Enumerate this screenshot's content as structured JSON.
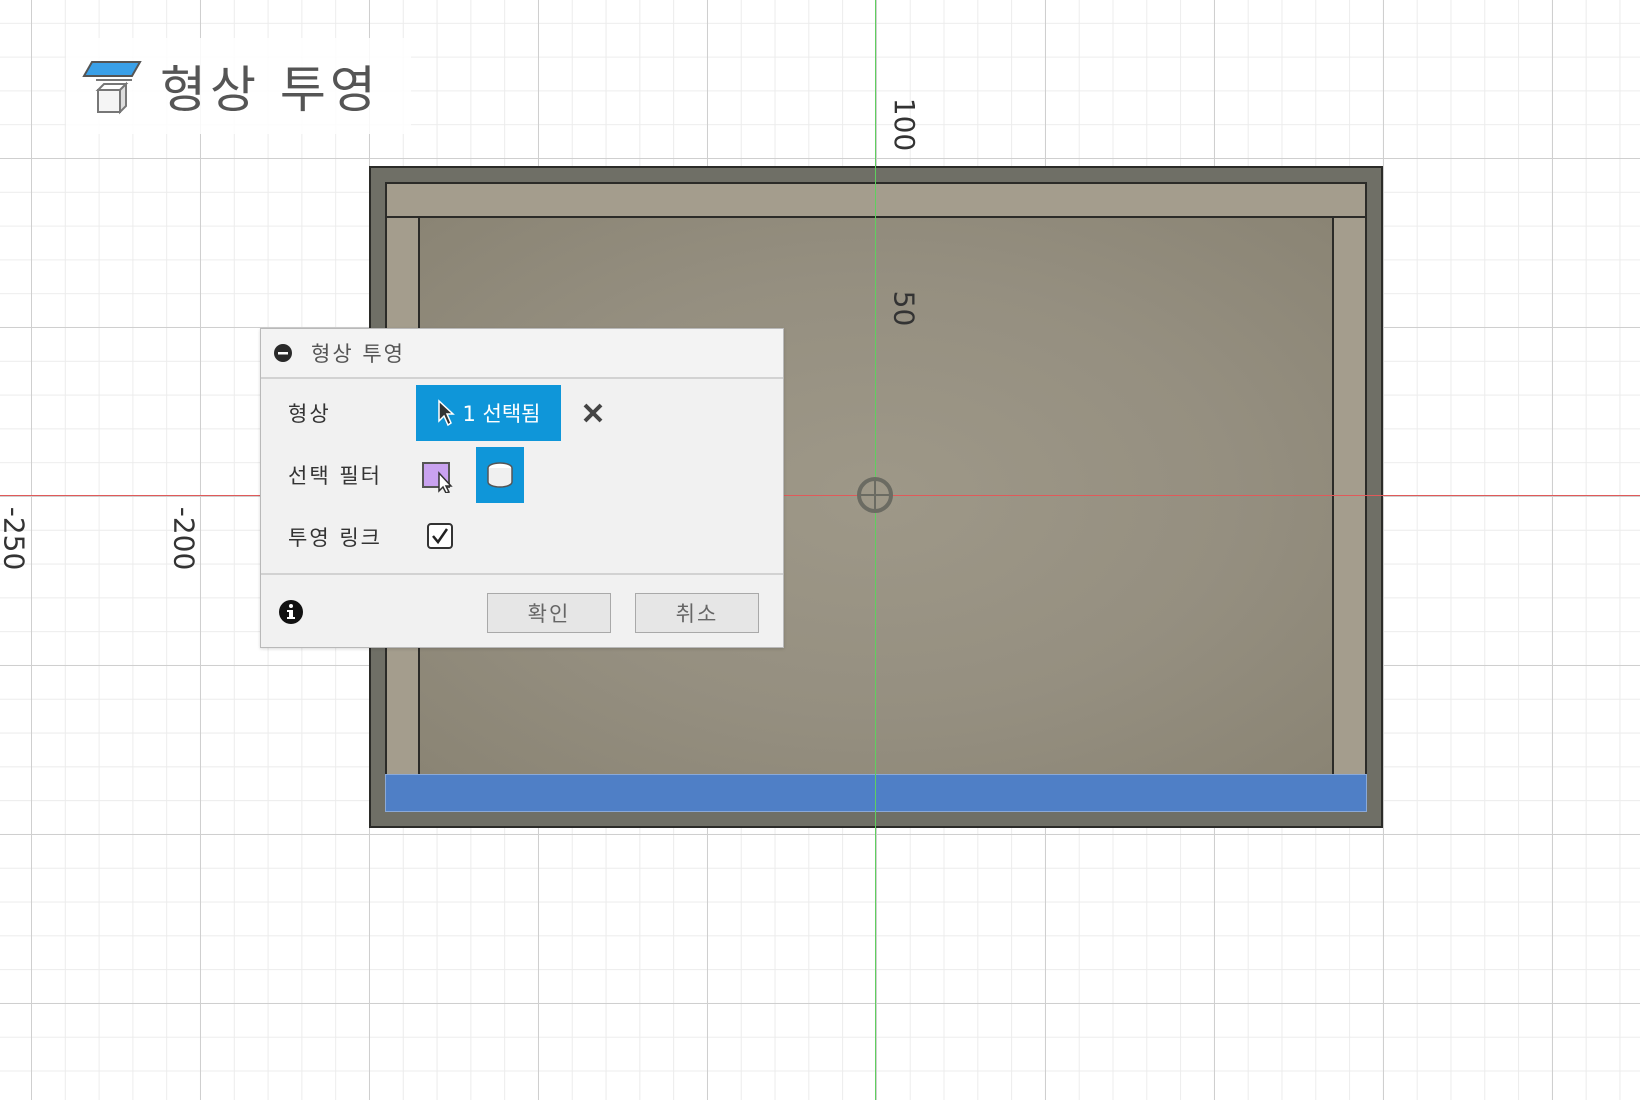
{
  "command_title": "형상 투영",
  "axis_labels": {
    "v100": "100",
    "v50": "50",
    "h_neg250": "-250",
    "h_neg200": "-200"
  },
  "dialog": {
    "title": "형상 투영",
    "geometry_label": "형상",
    "selection_button": "1 선택됨",
    "selection_filter_label": "선택 필터",
    "projection_link_label": "투영 링크",
    "projection_link_checked": true,
    "ok_label": "확인",
    "cancel_label": "취소"
  },
  "icons": {
    "command": "project-geometry-icon",
    "collapse": "collapse-minus-icon",
    "cursor": "cursor-arrow-icon",
    "clear": "close-x-icon",
    "face_filter": "face-select-icon",
    "body_filter": "body-select-icon",
    "info": "info-icon"
  },
  "colors": {
    "accent": "#0f96d9",
    "selected_face": "#4f7fc6",
    "axis_x": "#e05a5a",
    "axis_y": "#5fcf5f"
  }
}
